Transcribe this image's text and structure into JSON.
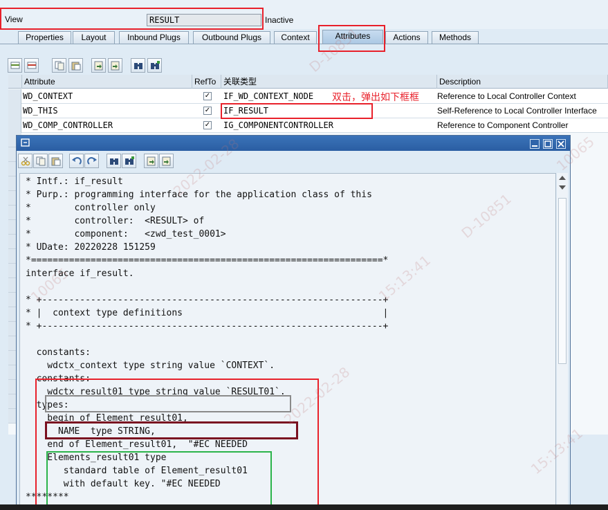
{
  "view": {
    "label": "View",
    "value": "RESULT",
    "status": "Inactive"
  },
  "tabs": [
    "Properties",
    "Layout",
    "Inbound Plugs",
    "Outbound Plugs",
    "Context",
    "Attributes",
    "Actions",
    "Methods"
  ],
  "active_tab": "Attributes",
  "table": {
    "headers": [
      "Attribute",
      "RefTo",
      "关联类型",
      "Description"
    ],
    "rows": [
      {
        "attribute": "WD_CONTEXT",
        "refto": "✓",
        "type": "IF_WD_CONTEXT_NODE",
        "description": "Reference to Local Controller Context"
      },
      {
        "attribute": "WD_THIS",
        "refto": "✓",
        "type": "IF_RESULT",
        "description": "Self-Reference to Local Controller Interface"
      },
      {
        "attribute": "WD_COMP_CONTROLLER",
        "refto": "✓",
        "type": "IG_COMPONENTCONTROLLER",
        "description": "Reference to Component Controller"
      }
    ]
  },
  "annotation": "双击，弹出如下框框",
  "code_lines": [
    "* Intf.: if_result",
    "* Purp.: programming interface for the application class of this",
    "*        controller only",
    "*        controller:  <RESULT> of",
    "*        component:   <zwd_test_0001>",
    "* UDate: 20220228 151259",
    "*=================================================================*",
    "interface if_result.",
    "",
    "* +---------------------------------------------------------------+",
    "* |  context type definitions                                     |",
    "* +---------------------------------------------------------------+",
    "",
    "  constants:",
    "    wdctx_context type string value `CONTEXT`.",
    "  constants:",
    "    wdctx_result01 type string value `RESULT01`.",
    "  types:",
    "    begin of Element_result01,",
    "      NAME  type STRING,",
    "    end of Element_result01,  \"#EC NEEDED",
    "    Elements_result01 type",
    "       standard table of Element_result01",
    "       with default key. \"#EC NEEDED",
    "********"
  ],
  "watermarks": [
    "D-10851",
    "15:13:41",
    "10065",
    "2022-02-28"
  ],
  "colors": {
    "annotation_red": "#e8202a",
    "title_blue": "#2a5ea3",
    "highlight_green": "#2bb44a"
  }
}
